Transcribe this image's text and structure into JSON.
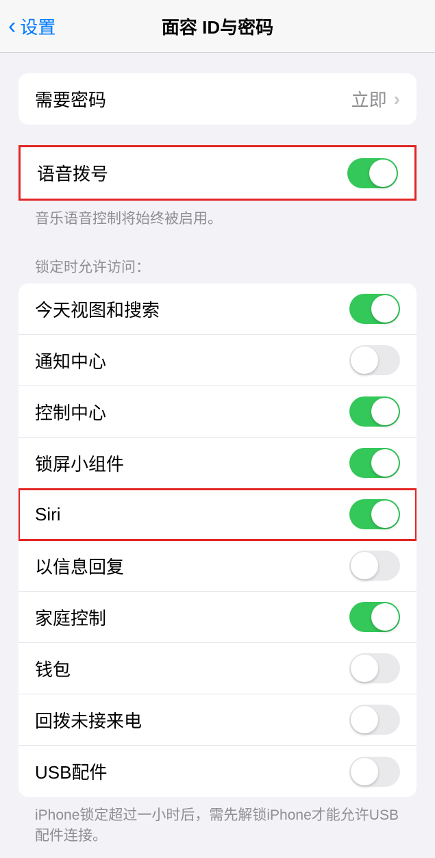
{
  "nav": {
    "back_label": "设置",
    "title": "面容 ID与密码"
  },
  "require_passcode": {
    "label": "需要密码",
    "value": "立即"
  },
  "voice_dial": {
    "label": "语音拨号",
    "footer": "音乐语音控制将始终被启用。"
  },
  "allow_access_header": "锁定时允许访问：",
  "allow_access": {
    "today": "今天视图和搜索",
    "notification": "通知中心",
    "control": "控制中心",
    "widgets": "锁屏小组件",
    "siri": "Siri",
    "reply": "以信息回复",
    "home": "家庭控制",
    "wallet": "钱包",
    "callback": "回拨未接来电",
    "usb": "USB配件"
  },
  "usb_footer": "iPhone锁定超过一小时后，需先解锁iPhone才能允许USB 配件连接。"
}
